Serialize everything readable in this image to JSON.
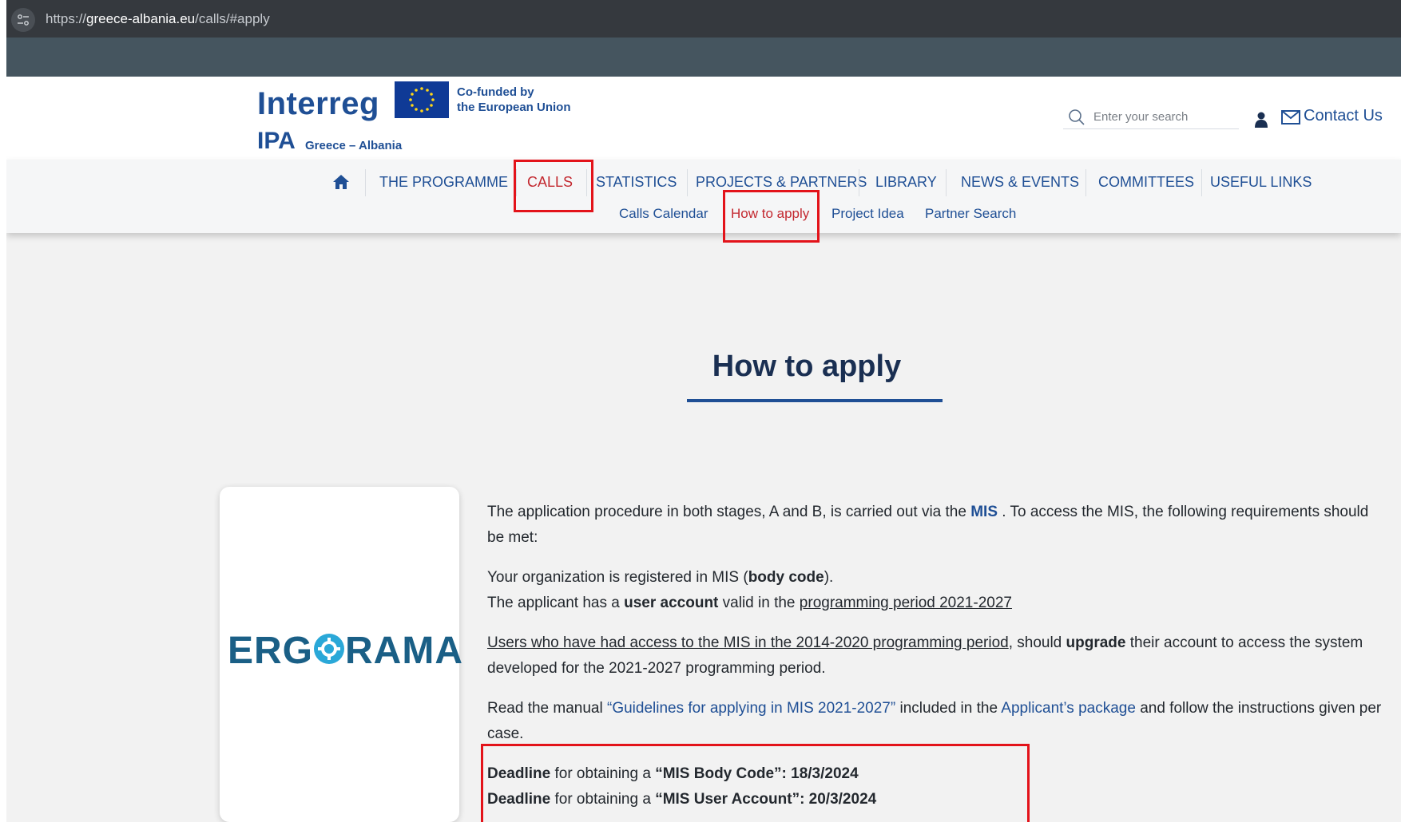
{
  "browser": {
    "url_prefix": "https://",
    "url_domain": "greece-albania.eu",
    "url_path": "/calls/#apply"
  },
  "header": {
    "logo_text": "Interreg",
    "cofunded_line1": "Co-funded by",
    "cofunded_line2": "the European Union",
    "ipa_text": "IPA",
    "region_text": "Greece – Albania",
    "search_placeholder": "Enter your search",
    "contact_label": "Contact Us"
  },
  "nav": {
    "items": [
      {
        "label": "THE PROGRAMME"
      },
      {
        "label": "CALLS",
        "active": true
      },
      {
        "label": "STATISTICS"
      },
      {
        "label": "PROJECTS & PARTNERS"
      },
      {
        "label": "LIBRARY"
      },
      {
        "label": "NEWS & EVENTS"
      },
      {
        "label": "COMMITTEES"
      },
      {
        "label": "USEFUL LINKS"
      }
    ],
    "sub_items": [
      {
        "label": "Calls Calendar"
      },
      {
        "label": "How to apply",
        "active": true
      },
      {
        "label": "Project Idea"
      },
      {
        "label": "Partner Search"
      }
    ]
  },
  "main": {
    "title": "How to apply",
    "card_logo": {
      "left": "ERG",
      "right": "RAMA"
    },
    "p1": {
      "a": "The application procedure in both stages, A and B, is carried out via the ",
      "link": "MIS",
      "b": " . To access the MIS, the following requirements should be met:"
    },
    "p2": {
      "line1_a": "Your organization is registered in MIS (",
      "line1_bold": "body code",
      "line1_b": ").",
      "line2_a": "The applicant has a ",
      "line2_bold": "user account",
      "line2_b": " valid in the ",
      "line2_link": "programming period 2021-2027"
    },
    "p3": {
      "link": "Users who have had access to the MIS in the 2014-2020 programming period",
      "a": ", should ",
      "bold": "upgrade",
      "b": " their account to access the system developed for the 2021-2027 programming period."
    },
    "p4": {
      "a": "Read the manual ",
      "link1": "“Guidelines for applying in MIS 2021-2027”",
      "b": " included in the ",
      "link2": "Applicant’s package",
      "c": " and follow the instructions given per case."
    },
    "deadlines": [
      {
        "label": "Deadline",
        "mid": " for obtaining a ",
        "item": "“MIS Body Code”: 18/3/2024"
      },
      {
        "label": "Deadline",
        "mid": " for obtaining a ",
        "item": "“MIS User Account”: 20/3/2024"
      }
    ]
  },
  "colors": {
    "brand_blue": "#1f4f95",
    "active_red": "#c3282f",
    "highlight_red": "#e3131a"
  }
}
